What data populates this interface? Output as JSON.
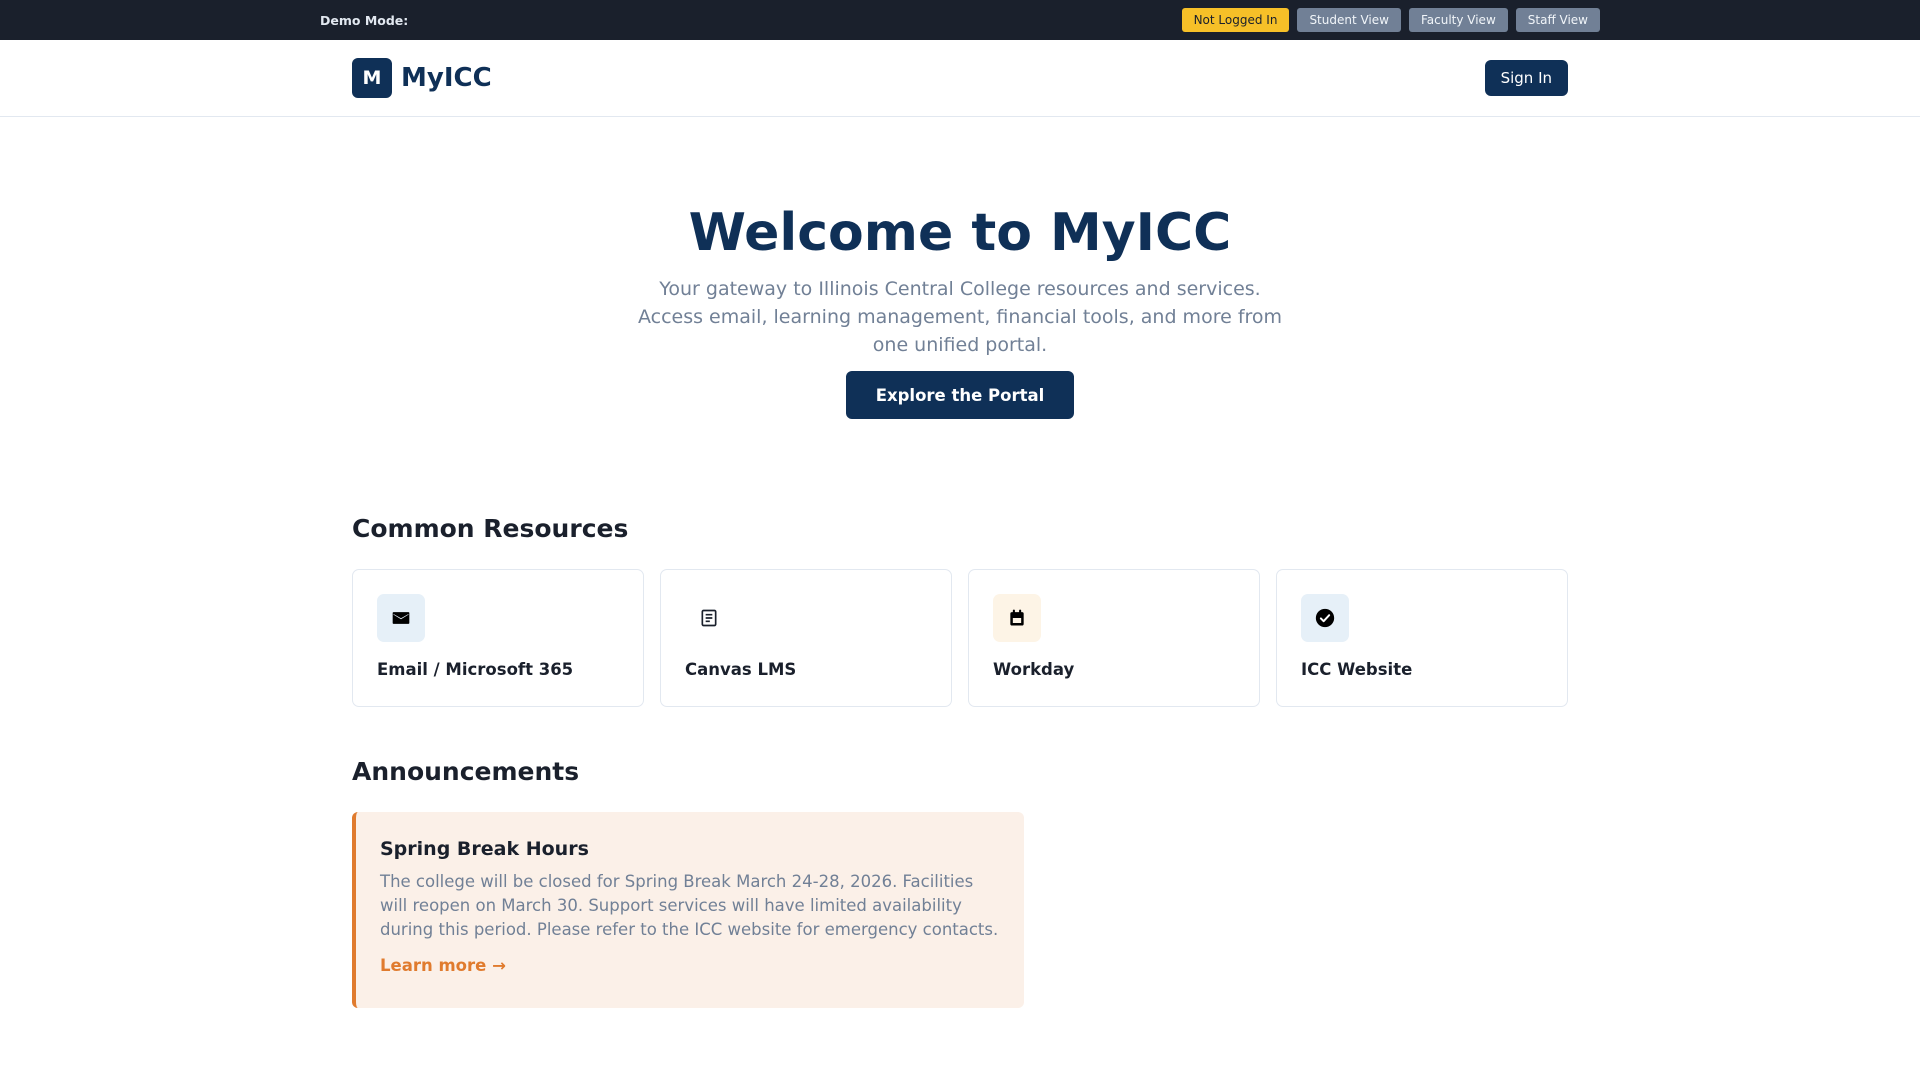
{
  "demo": {
    "label": "Demo Mode:",
    "buttons": [
      "Not Logged In",
      "Student View",
      "Faculty View",
      "Staff View"
    ],
    "active": "Not Logged In"
  },
  "header": {
    "logo_letter": "M",
    "brand": "MyICC",
    "signin_label": "Sign In"
  },
  "hero": {
    "title": "Welcome to MyICC",
    "subtitle": "Your gateway to Illinois Central College resources and services. Access email, learning management, financial tools, and more from one unified portal.",
    "button": "Explore the Portal"
  },
  "resources": {
    "title": "Common Resources",
    "items": [
      {
        "label": "Email / Microsoft 365",
        "icon": "mail-icon",
        "icon_bg": "#e6f0f8"
      },
      {
        "label": "Canvas LMS",
        "icon": "document-icon",
        "icon_bg": "#ffffff"
      },
      {
        "label": "Workday",
        "icon": "calendar-icon",
        "icon_bg": "#fdf4e6"
      },
      {
        "label": "ICC Website",
        "icon": "check-circle-icon",
        "icon_bg": "#e6f0f8"
      }
    ]
  },
  "announcements": {
    "title": "Announcements",
    "items": [
      {
        "title": "Spring Break Hours",
        "body": "The college will be closed for Spring Break March 24-28, 2026. Facilities will reopen on March 30. Support services will have limited availability during this period. Please refer to the ICC website for emergency contacts.",
        "link": "Learn more →"
      }
    ]
  },
  "colors": {
    "brand": "#0f3057",
    "accent": "#e07b2e",
    "demo_active": "#f6c028"
  }
}
